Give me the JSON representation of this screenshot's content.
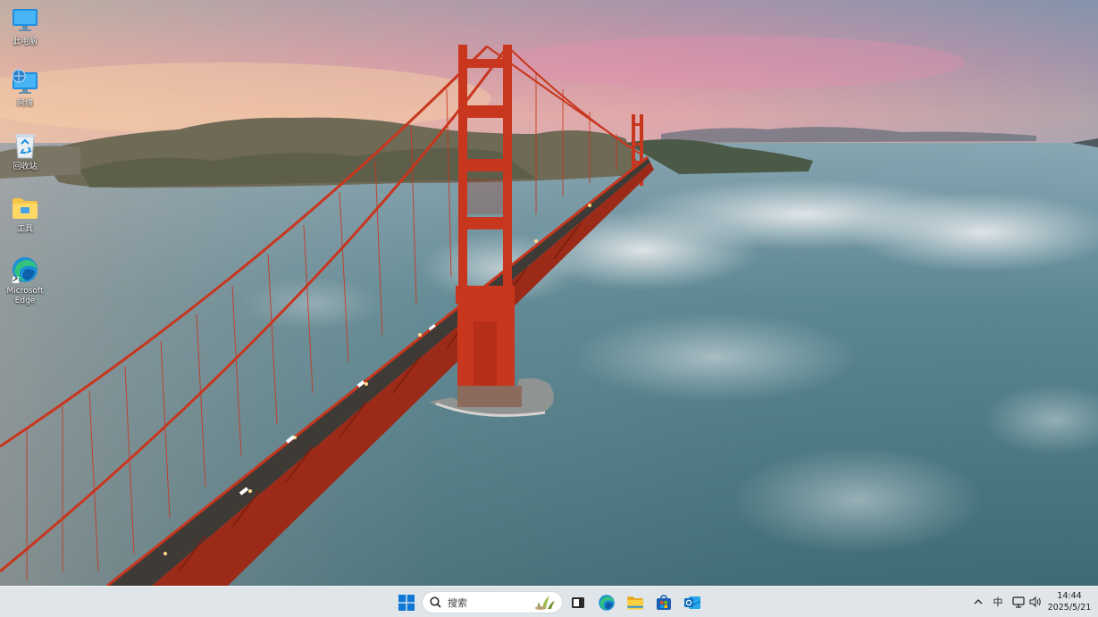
{
  "desktop": {
    "icons": [
      {
        "name": "this-pc",
        "label": "此电脑",
        "icon": "monitor-icon"
      },
      {
        "name": "network",
        "label": "网络",
        "icon": "network-icon"
      },
      {
        "name": "recycle-bin",
        "label": "回收站",
        "icon": "recycle-bin-icon"
      },
      {
        "name": "tools",
        "label": "工具",
        "icon": "folder-icon"
      },
      {
        "name": "edge",
        "label": "Microsoft Edge",
        "icon": "edge-icon"
      }
    ]
  },
  "taskbar": {
    "search_placeholder": "搜索",
    "pinned": [
      "start-icon",
      "task-view-icon",
      "edge-icon",
      "file-explorer-icon",
      "store-icon",
      "outlook-icon"
    ],
    "tray": {
      "ime": "中",
      "time": "14:44",
      "date": "2025/5/21"
    }
  },
  "colors": {
    "bridge": "#c8361e",
    "taskbar": "#eceef2",
    "accent": "#0067c0"
  }
}
